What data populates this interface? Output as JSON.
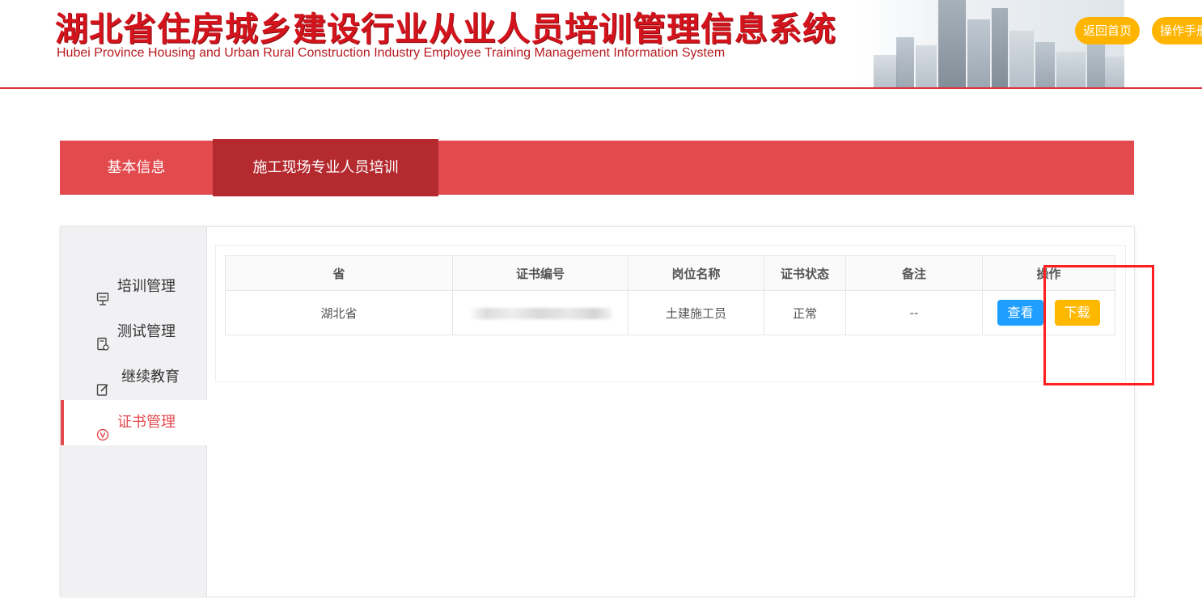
{
  "header": {
    "title_cn": "湖北省住房城乡建设行业从业人员培训管理信息系统",
    "title_en": "Hubei Province Housing and Urban Rural Construction Industry Employee Training Management Information System",
    "home_button": "返回首页",
    "manual_button": "操作手册",
    "accent_color": "#d4141c"
  },
  "tabs": [
    {
      "label": "基本信息",
      "active": false
    },
    {
      "label": "施工现场专业人员培训",
      "active": true
    }
  ],
  "sidebar": {
    "items": [
      {
        "label": "培训管理",
        "icon": "training-icon",
        "active": false
      },
      {
        "label": "测试管理",
        "icon": "test-icon",
        "active": false
      },
      {
        "label": "继续教育",
        "icon": "edit-icon",
        "active": false
      },
      {
        "label": "证书管理",
        "icon": "certificate-icon",
        "active": true
      }
    ]
  },
  "table": {
    "columns": [
      "省",
      "证书编号",
      "岗位名称",
      "证书状态",
      "备注",
      "操作"
    ],
    "rows": [
      {
        "province": "湖北省",
        "cert_no_visible": "",
        "position": "土建施工员",
        "status": "正常",
        "remark": "--",
        "view_label": "查看",
        "download_label": "下载"
      }
    ]
  },
  "colors": {
    "tab_bar": "#e34a4e",
    "tab_active": "#b42a2f",
    "view_button": "#1e9fff",
    "download_button": "#ffb800",
    "highlight_box": "#ff1f1f"
  }
}
